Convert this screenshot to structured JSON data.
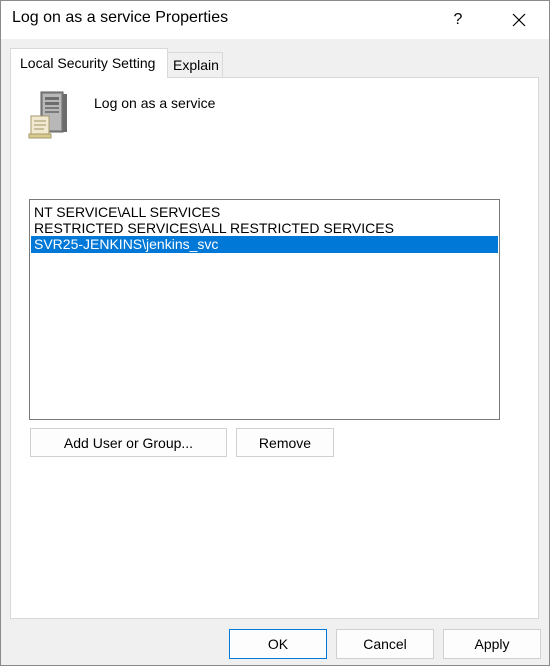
{
  "window": {
    "title": "Log on as a service Properties",
    "help_glyph": "?",
    "close_icon": "close-icon"
  },
  "tabs": [
    {
      "label": "Local Security Setting",
      "active": true
    },
    {
      "label": "Explain",
      "active": false
    }
  ],
  "policy": {
    "icon": "server-policy-icon",
    "name": "Log on as a service"
  },
  "accounts": {
    "items": [
      "NT SERVICE\\ALL SERVICES",
      "RESTRICTED SERVICES\\ALL RESTRICTED SERVICES",
      "SVR25-JENKINS\\jenkins_svc"
    ],
    "selected_index": 2
  },
  "actions": {
    "add_label": "Add User or Group...",
    "remove_label": "Remove"
  },
  "footer": {
    "ok_label": "OK",
    "cancel_label": "Cancel",
    "apply_label": "Apply"
  },
  "colors": {
    "selection": "#0078d7",
    "dialog_background": "#f0f0f0",
    "panel_background": "#ffffff"
  }
}
